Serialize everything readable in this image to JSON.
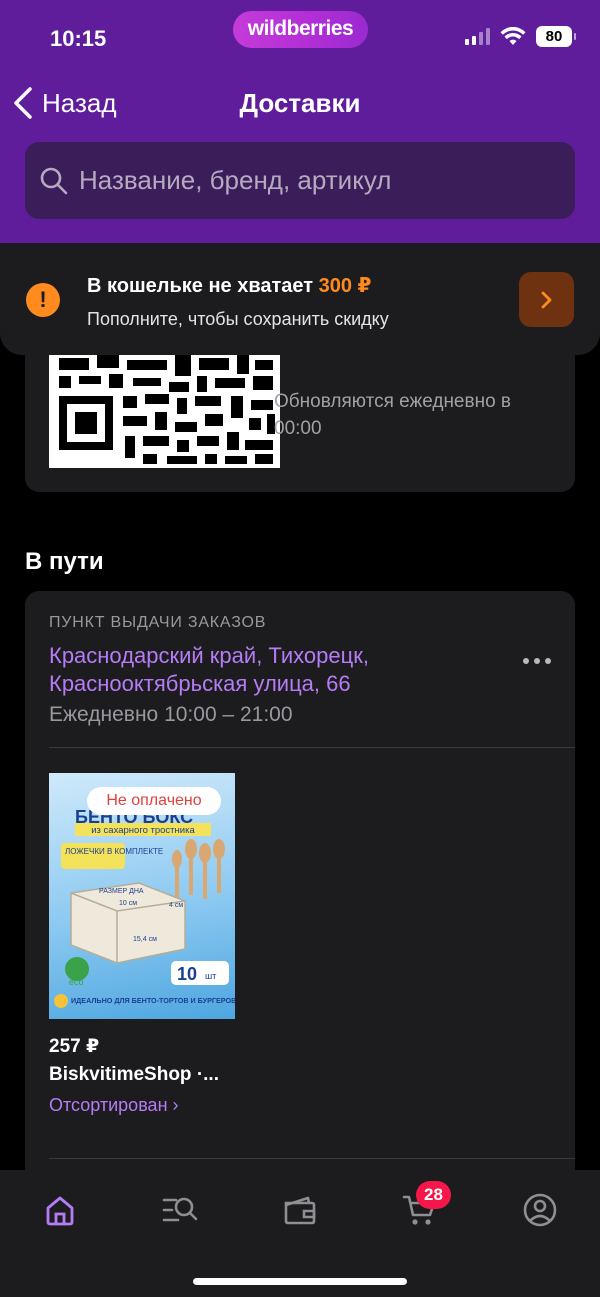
{
  "status_bar": {
    "time": "10:15",
    "battery": "80"
  },
  "brand": {
    "logo_text": "wildberries"
  },
  "nav": {
    "back_label": "Назад",
    "title": "Доставки"
  },
  "search": {
    "placeholder": "Название, бренд, артикул"
  },
  "wallet_banner": {
    "title_prefix": "В кошельке не хватает",
    "amount": "300 ₽",
    "subtitle": "Пополните, чтобы сохранить скидку"
  },
  "qr_card": {
    "note": "Обновляются ежедневно в 00:00"
  },
  "section": {
    "title": "В пути"
  },
  "order": {
    "pickup_label": "ПУНКТ ВЫДАЧИ ЗАКАЗОВ",
    "address": "Краснодарский край, Тихорецк, Краснооктябрьская улица, 66",
    "hours": "Ежедневно 10:00 – 21:00",
    "item": {
      "badge": "Не оплачено",
      "price": "257 ₽",
      "seller": "BiskvitimeShop ·...",
      "status": "Отсортирован ›",
      "image_text": {
        "title": "БЕНТО БОКС",
        "subtitle": "из сахарного тростника",
        "spoons": "ЛОЖЕЧКИ В КОМПЛЕКТЕ",
        "size": "РАЗМЕР ДНА",
        "dim_10": "10 см",
        "dim_154": "15,4 см",
        "dim_4": "4 см",
        "count": "10",
        "count_unit": "шт",
        "eco": "eco",
        "footer": "ИДЕАЛЬНО ДЛЯ БЕНТО-ТОРТОВ И БУРГЕРОВ"
      }
    }
  },
  "tab_bar": {
    "cart_badge": "28",
    "active_tab": "home",
    "accent": "#b67cf6",
    "icons": [
      "home-icon",
      "catalog-search-icon",
      "wallet-icon",
      "cart-icon",
      "profile-icon"
    ]
  },
  "colors": {
    "header_purple": "#5f1d9c",
    "link_purple": "#b67cf6",
    "warning_orange": "#ff8a1e",
    "badge_red": "#f5174a"
  }
}
